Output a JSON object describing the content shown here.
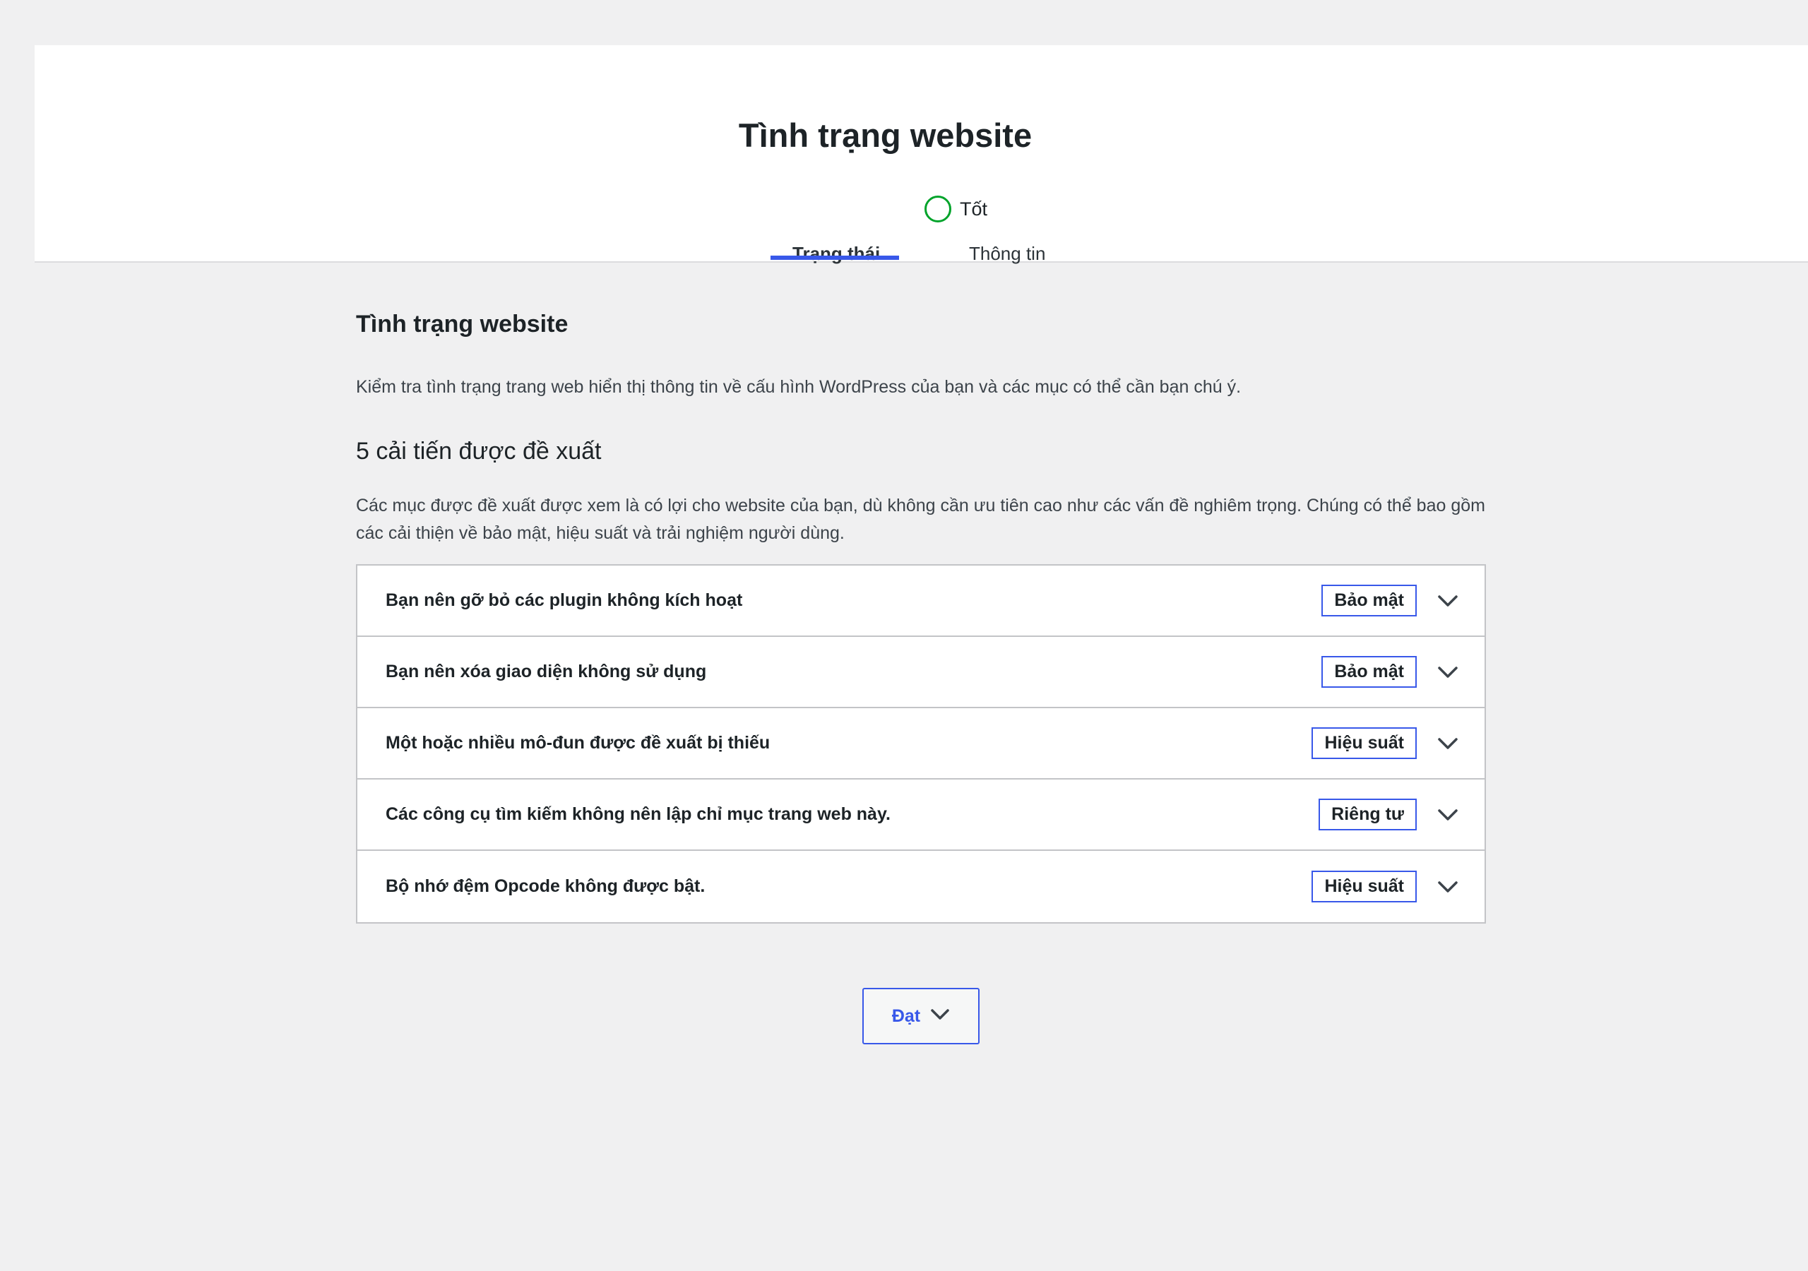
{
  "header": {
    "title": "Tình trạng website",
    "status_label": "Tốt",
    "status_color": "#00a32a",
    "tabs": [
      {
        "label": "Trạng thái",
        "active": true
      },
      {
        "label": "Thông tin",
        "active": false
      }
    ],
    "accent_color": "#3858e9"
  },
  "main": {
    "section_title": "Tình trạng website",
    "section_desc": "Kiểm tra tình trạng trang web hiển thị thông tin về cấu hình WordPress của bạn và các mục có thể cần bạn chú ý.",
    "recommended_title": "5 cải tiến được đề xuất",
    "recommended_desc": "Các mục được đề xuất được xem là có lợi cho website của bạn, dù không cần ưu tiên cao như các vấn đề nghiêm trọng. Chúng có thể bao gồm các cải thiện về bảo mật, hiệu suất và trải nghiệm người dùng.",
    "items": [
      {
        "title": "Bạn nên gỡ bỏ các plugin không kích hoạt",
        "badge": "Bảo mật",
        "chevron_icon": "chevron-down-icon"
      },
      {
        "title": "Bạn nên xóa giao diện không sử dụng",
        "badge": "Bảo mật",
        "chevron_icon": "chevron-down-icon"
      },
      {
        "title": "Một hoặc nhiều mô-đun được đề xuất bị thiếu",
        "badge": "Hiệu suất",
        "chevron_icon": "chevron-down-icon"
      },
      {
        "title": "Các công cụ tìm kiếm không nên lập chỉ mục trang web này.",
        "badge": "Riêng tư",
        "chevron_icon": "chevron-down-icon"
      },
      {
        "title": "Bộ nhớ đệm Opcode không được bật.",
        "badge": "Hiệu suất",
        "chevron_icon": "chevron-down-icon"
      }
    ],
    "passed_button_label": "Đạt"
  }
}
